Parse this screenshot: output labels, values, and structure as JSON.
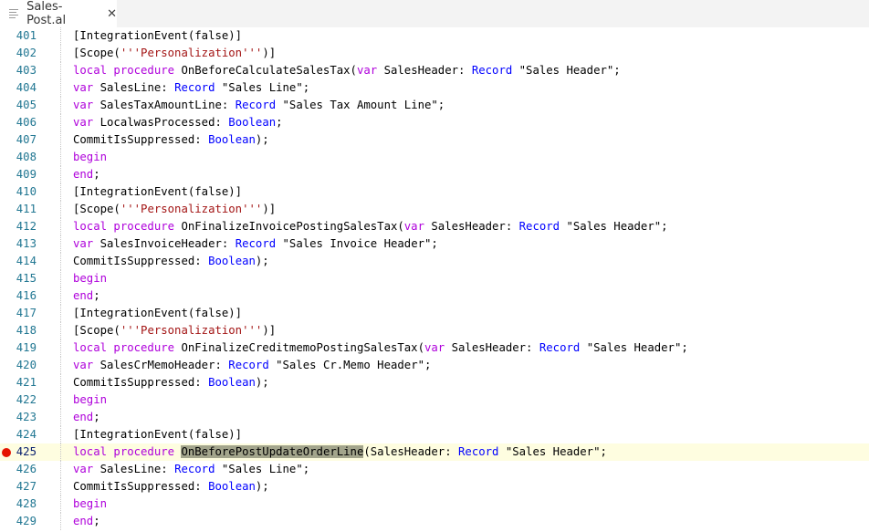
{
  "tab": {
    "title": "Sales-Post.al",
    "close": "✕",
    "icon": "file-lines-icon"
  },
  "colors": {
    "keyword": "#af00db",
    "type": "#0000ff",
    "string": "#a31515",
    "line_number": "#237893",
    "breakpoint": "#e51400",
    "current_line": "#fefde0",
    "highlight": "#a3a58c"
  },
  "editor": {
    "current_line": 425,
    "breakpoint_line": 425,
    "lines": [
      {
        "num": "401",
        "tokens": [
          {
            "t": "[IntegrationEvent(false)]",
            "c": "plain"
          }
        ]
      },
      {
        "num": "402",
        "tokens": [
          {
            "t": "[Scope(",
            "c": "plain"
          },
          {
            "t": "'''Personalization'''",
            "c": "str"
          },
          {
            "t": ")]",
            "c": "plain"
          }
        ]
      },
      {
        "num": "403",
        "tokens": [
          {
            "t": "local procedure",
            "c": "kw"
          },
          {
            "t": " OnBeforeCalculateSalesTax(",
            "c": "plain"
          },
          {
            "t": "var",
            "c": "kw"
          },
          {
            "t": " SalesHeader: ",
            "c": "plain"
          },
          {
            "t": "Record",
            "c": "type"
          },
          {
            "t": " \"Sales Header\";",
            "c": "plain"
          }
        ]
      },
      {
        "num": "404",
        "tokens": [
          {
            "t": "var",
            "c": "kw"
          },
          {
            "t": " SalesLine: ",
            "c": "plain"
          },
          {
            "t": "Record",
            "c": "type"
          },
          {
            "t": " \"Sales Line\";",
            "c": "plain"
          }
        ]
      },
      {
        "num": "405",
        "tokens": [
          {
            "t": "var",
            "c": "kw"
          },
          {
            "t": " SalesTaxAmountLine: ",
            "c": "plain"
          },
          {
            "t": "Record",
            "c": "type"
          },
          {
            "t": " \"Sales Tax Amount Line\";",
            "c": "plain"
          }
        ]
      },
      {
        "num": "406",
        "tokens": [
          {
            "t": "var",
            "c": "kw"
          },
          {
            "t": " LocalwasProcessed: ",
            "c": "plain"
          },
          {
            "t": "Boolean",
            "c": "type"
          },
          {
            "t": ";",
            "c": "plain"
          }
        ]
      },
      {
        "num": "407",
        "tokens": [
          {
            "t": "CommitIsSuppressed: ",
            "c": "plain"
          },
          {
            "t": "Boolean",
            "c": "type"
          },
          {
            "t": ");",
            "c": "plain"
          }
        ]
      },
      {
        "num": "408",
        "tokens": [
          {
            "t": "begin",
            "c": "kw"
          }
        ]
      },
      {
        "num": "409",
        "tokens": [
          {
            "t": "end",
            "c": "kw"
          },
          {
            "t": ";",
            "c": "plain"
          }
        ]
      },
      {
        "num": "410",
        "tokens": [
          {
            "t": "[IntegrationEvent(false)]",
            "c": "plain"
          }
        ]
      },
      {
        "num": "411",
        "tokens": [
          {
            "t": "[Scope(",
            "c": "plain"
          },
          {
            "t": "'''Personalization'''",
            "c": "str"
          },
          {
            "t": ")]",
            "c": "plain"
          }
        ]
      },
      {
        "num": "412",
        "tokens": [
          {
            "t": "local procedure",
            "c": "kw"
          },
          {
            "t": " OnFinalizeInvoicePostingSalesTax(",
            "c": "plain"
          },
          {
            "t": "var",
            "c": "kw"
          },
          {
            "t": " SalesHeader: ",
            "c": "plain"
          },
          {
            "t": "Record",
            "c": "type"
          },
          {
            "t": " \"Sales Header\";",
            "c": "plain"
          }
        ]
      },
      {
        "num": "413",
        "tokens": [
          {
            "t": "var",
            "c": "kw"
          },
          {
            "t": " SalesInvoiceHeader: ",
            "c": "plain"
          },
          {
            "t": "Record",
            "c": "type"
          },
          {
            "t": " \"Sales Invoice Header\";",
            "c": "plain"
          }
        ]
      },
      {
        "num": "414",
        "tokens": [
          {
            "t": "CommitIsSuppressed: ",
            "c": "plain"
          },
          {
            "t": "Boolean",
            "c": "type"
          },
          {
            "t": ");",
            "c": "plain"
          }
        ]
      },
      {
        "num": "415",
        "tokens": [
          {
            "t": "begin",
            "c": "kw"
          }
        ]
      },
      {
        "num": "416",
        "tokens": [
          {
            "t": "end",
            "c": "kw"
          },
          {
            "t": ";",
            "c": "plain"
          }
        ]
      },
      {
        "num": "417",
        "tokens": [
          {
            "t": "[IntegrationEvent(false)]",
            "c": "plain"
          }
        ]
      },
      {
        "num": "418",
        "tokens": [
          {
            "t": "[Scope(",
            "c": "plain"
          },
          {
            "t": "'''Personalization'''",
            "c": "str"
          },
          {
            "t": ")]",
            "c": "plain"
          }
        ]
      },
      {
        "num": "419",
        "tokens": [
          {
            "t": "local procedure",
            "c": "kw"
          },
          {
            "t": " OnFinalizeCreditmemoPostingSalesTax(",
            "c": "plain"
          },
          {
            "t": "var",
            "c": "kw"
          },
          {
            "t": " SalesHeader: ",
            "c": "plain"
          },
          {
            "t": "Record",
            "c": "type"
          },
          {
            "t": " \"Sales Header\";",
            "c": "plain"
          }
        ]
      },
      {
        "num": "420",
        "tokens": [
          {
            "t": "var",
            "c": "kw"
          },
          {
            "t": " SalesCrMemoHeader: ",
            "c": "plain"
          },
          {
            "t": "Record",
            "c": "type"
          },
          {
            "t": " \"Sales Cr.Memo Header\";",
            "c": "plain"
          }
        ]
      },
      {
        "num": "421",
        "tokens": [
          {
            "t": "CommitIsSuppressed: ",
            "c": "plain"
          },
          {
            "t": "Boolean",
            "c": "type"
          },
          {
            "t": ");",
            "c": "plain"
          }
        ]
      },
      {
        "num": "422",
        "tokens": [
          {
            "t": "begin",
            "c": "kw"
          }
        ]
      },
      {
        "num": "423",
        "tokens": [
          {
            "t": "end",
            "c": "kw"
          },
          {
            "t": ";",
            "c": "plain"
          }
        ]
      },
      {
        "num": "424",
        "tokens": [
          {
            "t": "[IntegrationEvent(false)]",
            "c": "plain"
          }
        ]
      },
      {
        "num": "425",
        "tokens": [
          {
            "t": "local procedure",
            "c": "kw"
          },
          {
            "t": " ",
            "c": "plain"
          },
          {
            "t": "OnBeforePostUpdateOrderLine",
            "c": "hl"
          },
          {
            "t": "(SalesHeader: ",
            "c": "plain"
          },
          {
            "t": "Record",
            "c": "type"
          },
          {
            "t": " \"Sales Header\";",
            "c": "plain"
          }
        ]
      },
      {
        "num": "426",
        "tokens": [
          {
            "t": "var",
            "c": "kw"
          },
          {
            "t": " SalesLine: ",
            "c": "plain"
          },
          {
            "t": "Record",
            "c": "type"
          },
          {
            "t": " \"Sales Line\";",
            "c": "plain"
          }
        ]
      },
      {
        "num": "427",
        "tokens": [
          {
            "t": "CommitIsSuppressed: ",
            "c": "plain"
          },
          {
            "t": "Boolean",
            "c": "type"
          },
          {
            "t": ");",
            "c": "plain"
          }
        ]
      },
      {
        "num": "428",
        "tokens": [
          {
            "t": "begin",
            "c": "kw"
          }
        ]
      },
      {
        "num": "429",
        "tokens": [
          {
            "t": "end",
            "c": "kw"
          },
          {
            "t": ";",
            "c": "plain"
          }
        ]
      }
    ]
  }
}
